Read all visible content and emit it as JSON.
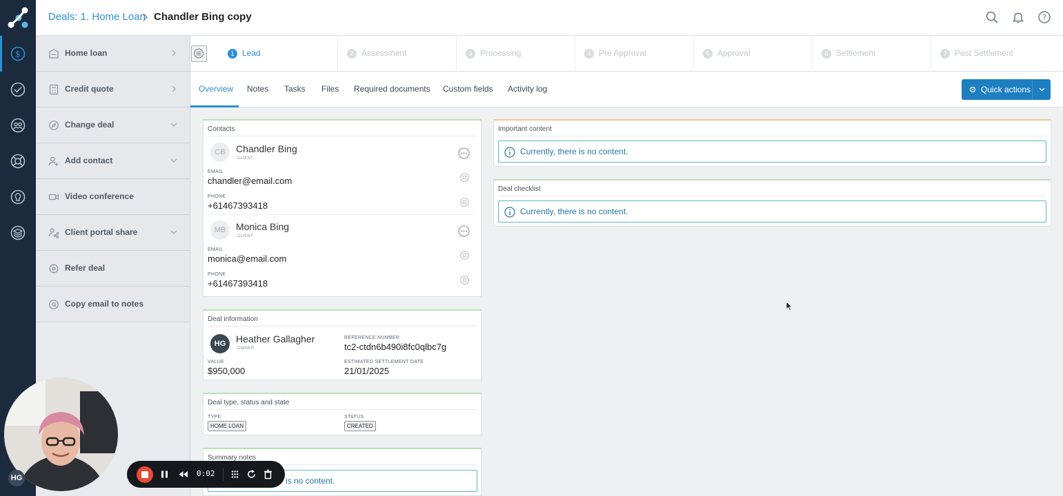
{
  "app": {
    "breadcrumb_link": "Deals: 1. Home Loan",
    "breadcrumb_title": "Chandler Bing copy"
  },
  "colors": {
    "accent": "#2d8fd5",
    "rail_bg": "#1b2a3c",
    "quick_actions_bg": "#1d7fc0",
    "card_top_green": "#b9e3b3",
    "card_top_orange": "#f0c790",
    "recording_red": "#e84a35"
  },
  "sidebar": {
    "items": [
      {
        "label": "Home loan",
        "icon": "home-loan-icon",
        "arrow": "right"
      },
      {
        "label": "Credit quote",
        "icon": "calculator-icon",
        "arrow": "right"
      },
      {
        "label": "Change deal",
        "icon": "compass-icon",
        "arrow": "down"
      },
      {
        "label": "Add contact",
        "icon": "add-person-icon",
        "arrow": "down"
      },
      {
        "label": "Video conference",
        "icon": "video-icon",
        "arrow": "none"
      },
      {
        "label": "Client portal share",
        "icon": "share-icon",
        "arrow": "down"
      },
      {
        "label": "Refer deal",
        "icon": "refer-icon",
        "arrow": "none"
      },
      {
        "label": "Copy email to notes",
        "icon": "email-copy-icon",
        "arrow": "none"
      }
    ]
  },
  "stages": [
    {
      "num": "1",
      "label": "Lead"
    },
    {
      "num": "2",
      "label": "Assessment"
    },
    {
      "num": "3",
      "label": "Processing"
    },
    {
      "num": "4",
      "label": "Pre Approval"
    },
    {
      "num": "5",
      "label": "Approval"
    },
    {
      "num": "6",
      "label": "Settlement"
    },
    {
      "num": "7",
      "label": "Post Settlement"
    }
  ],
  "current_stage": "Lead",
  "tabs": [
    "Overview",
    "Notes",
    "Tasks",
    "Files",
    "Required documents",
    "Custom fields",
    "Activity log"
  ],
  "active_tab": "Overview",
  "quick_actions": {
    "label": "Quick actions"
  },
  "contacts": {
    "title": "Contacts",
    "people": [
      {
        "initials": "CB",
        "name": "Chandler Bing",
        "role": "CLIENT",
        "email_label": "EMAIL",
        "email": "chandler@email.com",
        "phone_label": "PHONE",
        "phone": "+61467393418"
      },
      {
        "initials": "MB",
        "name": "Monica Bing",
        "role": "CLIENT",
        "email_label": "EMAIL",
        "email": "monica@email.com",
        "phone_label": "PHONE",
        "phone": "+61467393418"
      }
    ]
  },
  "deal_info": {
    "title": "Deal information",
    "owner_initials": "HG",
    "owner_name": "Heather Gallagher",
    "owner_role": "OWNER",
    "ref_label": "REFERENCE NUMBER",
    "ref_value": "tc2-ctdn6b490i8fc0qlbc7g",
    "value_label": "VALUE",
    "value": "$950,000",
    "settle_label": "ESTIMATED SETTLEMENT DATE",
    "settle_value": "21/01/2025"
  },
  "deal_type": {
    "title": "Deal type, status and state",
    "type_label": "TYPE",
    "type_value": "HOME LOAN",
    "status_label": "STATUS",
    "status_value": "CREATED"
  },
  "summary_notes": {
    "title": "Summary notes",
    "empty": "is no content."
  },
  "important_content": {
    "title": "Important content",
    "empty": "Currently, there is no content."
  },
  "deal_checklist": {
    "title": "Deal checklist",
    "empty": "Currently, there is no content."
  },
  "recorder": {
    "time": "0:02"
  },
  "user": {
    "initials": "HG"
  }
}
